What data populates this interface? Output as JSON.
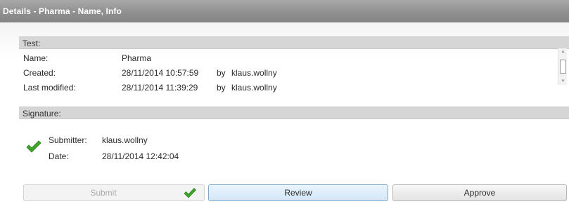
{
  "window": {
    "title": "Details - Pharma - Name, Info"
  },
  "test": {
    "header": "Test:",
    "name_label": "Name:",
    "name_value": "Pharma",
    "created_label": "Created:",
    "created_value": "28/11/2014 10:57:59",
    "created_by": "by",
    "created_user": "klaus.wollny",
    "modified_label": "Last modified:",
    "modified_value": "28/11/2014 11:39:29",
    "modified_by": "by",
    "modified_user": "klaus.wollny"
  },
  "signature": {
    "header": "Signature:",
    "submitter_label": "Submitter:",
    "submitter_value": "klaus.wollny",
    "date_label": "Date:",
    "date_value": "28/11/2014 12:42:04",
    "status_icon": "green-checkmark-icon",
    "status_color": "#3fa52b"
  },
  "scrollbar": {
    "up_glyph": "▲",
    "down_glyph": "▼"
  },
  "buttons": {
    "submit_label": "Submit",
    "submit_state": "disabled",
    "review_label": "Review",
    "approve_label": "Approve"
  },
  "colors": {
    "titlebar": "#8e8e8e",
    "section_header": "#d6d6d6",
    "review_button": "#d3e7f8",
    "check_green": "#3fa52b"
  }
}
